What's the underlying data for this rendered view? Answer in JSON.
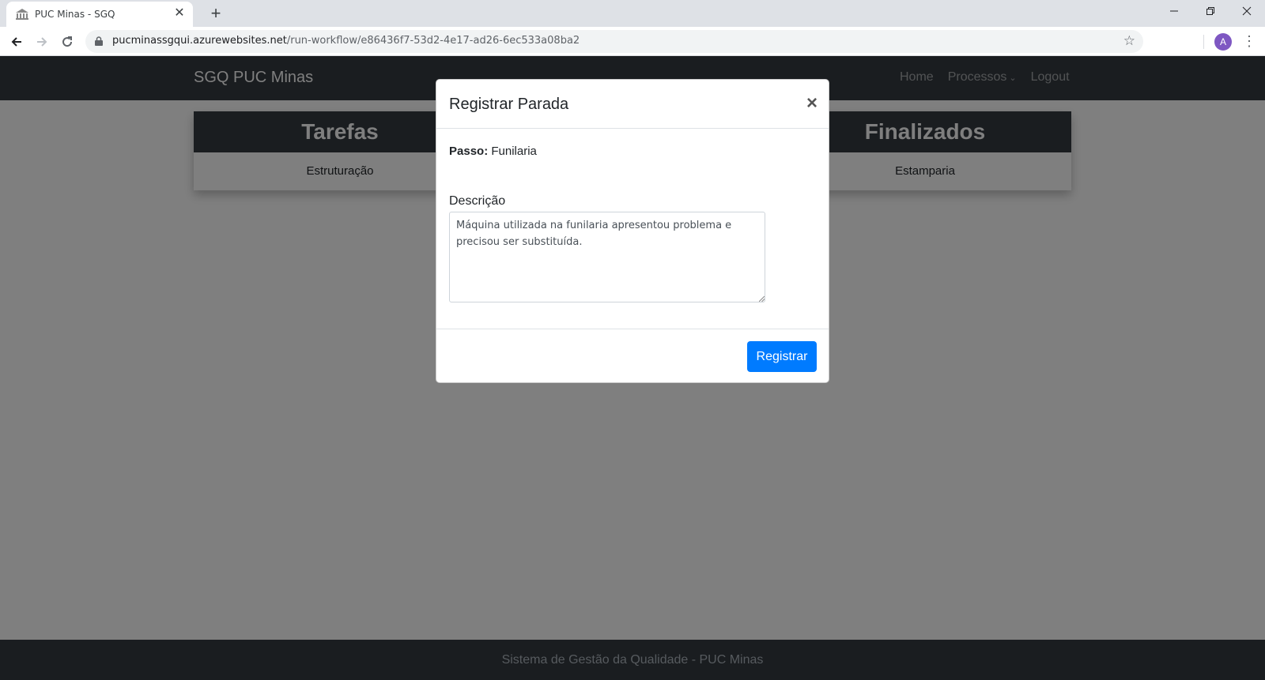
{
  "browser": {
    "tab_title": "PUC Minas - SGQ",
    "tab_close_glyph": "✕",
    "new_tab_glyph": "+",
    "url_host": "pucminassgqui.azurewebsites.net",
    "url_path": "/run-workflow/e86436f7-53d2-4e17-ad26-6ec533a08ba2",
    "profile_initial": "A",
    "icons": [
      "favicon-icon",
      "back-arrow-icon",
      "forward-arrow-icon",
      "reload-icon",
      "lock-icon",
      "star-icon",
      "menu-dots-icon",
      "minimize-icon",
      "maximize-icon",
      "close-icon"
    ]
  },
  "navbar": {
    "brand": "SGQ PUC Minas",
    "links": {
      "home": "Home",
      "processes": "Processos",
      "logout": "Logout"
    }
  },
  "columns": [
    {
      "title": "Tarefas",
      "item": "Estruturação"
    },
    {
      "title": "Finalizados",
      "item": "Estamparia"
    }
  ],
  "modal": {
    "title": "Registrar Parada",
    "step_label": "Passo:",
    "step_value": "Funilaria",
    "description_label": "Descrição",
    "description_value": "Máquina utilizada na funilaria apresentou problema e precisou ser substituída.",
    "submit_label": "Registrar"
  },
  "footer": {
    "text": "Sistema de Gestão da Qualidade - PUC Minas"
  },
  "colors": {
    "navbar_bg": "#343a40",
    "primary": "#007bff",
    "backdrop": "rgba(0,0,0,0.5)"
  }
}
